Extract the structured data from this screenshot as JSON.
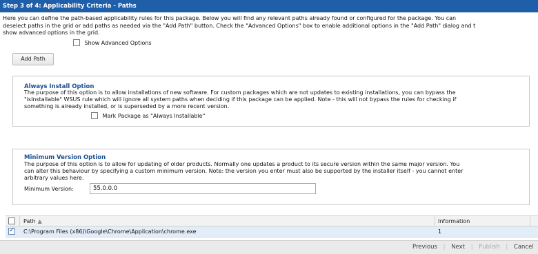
{
  "header": {
    "title": "Step 3 of 4: Applicability Criteria - Paths"
  },
  "intro": {
    "line1": "Here you can define the path-based applicability rules for this package. Below you will find any relevant paths already found or configured for the package. You can",
    "line2": "deselect paths in the grid or add paths as needed via the \"Add Path\" button. Check the \"Advanced Options\" box to enable additional options in the \"Add Path\" dialog and t",
    "line3": "show advanced options in the grid."
  },
  "advanced": {
    "label": "Show Advanced Options",
    "checked": false
  },
  "toolbar": {
    "add_path_label": "Add Path"
  },
  "always_install": {
    "title": "Always Install Option",
    "line1": "The purpose of this option is to allow installations of new software. For custom packages which are not updates to existing installations, you can bypass the",
    "line2": "\"isInstallable\" WSUS rule which will ignore all system paths when deciding if this package can be applied. Note - this will not bypass the rules for checking if",
    "line3": "something is already installed, or is superseded by a more recent version.",
    "checkbox_label": "Mark Package as \"Always Installable\"",
    "checked": false
  },
  "minimum_version": {
    "title": "Minimum Version Option",
    "line1": "The purpose of this option is to allow for updating of older products. Normally one updates a product to its secure version within the same major version. You",
    "line2": "can alter this behaviour by specifying a custom minimum version. Note: the version you enter must also be supported by the installer itself - you cannot enter",
    "line3": "arbitrary values here.",
    "field_label": "Minimum Version:",
    "field_value": "55.0.0.0"
  },
  "grid": {
    "columns": {
      "path": "Path",
      "information": "Information"
    },
    "rows": [
      {
        "checked": true,
        "path": "C:\\Program Files (x86)\\Google\\Chrome\\Application\\chrome.exe",
        "information": "1"
      }
    ]
  },
  "footer": {
    "previous": "Previous",
    "next": "Next",
    "publish": "Publish",
    "cancel": "Cancel"
  }
}
